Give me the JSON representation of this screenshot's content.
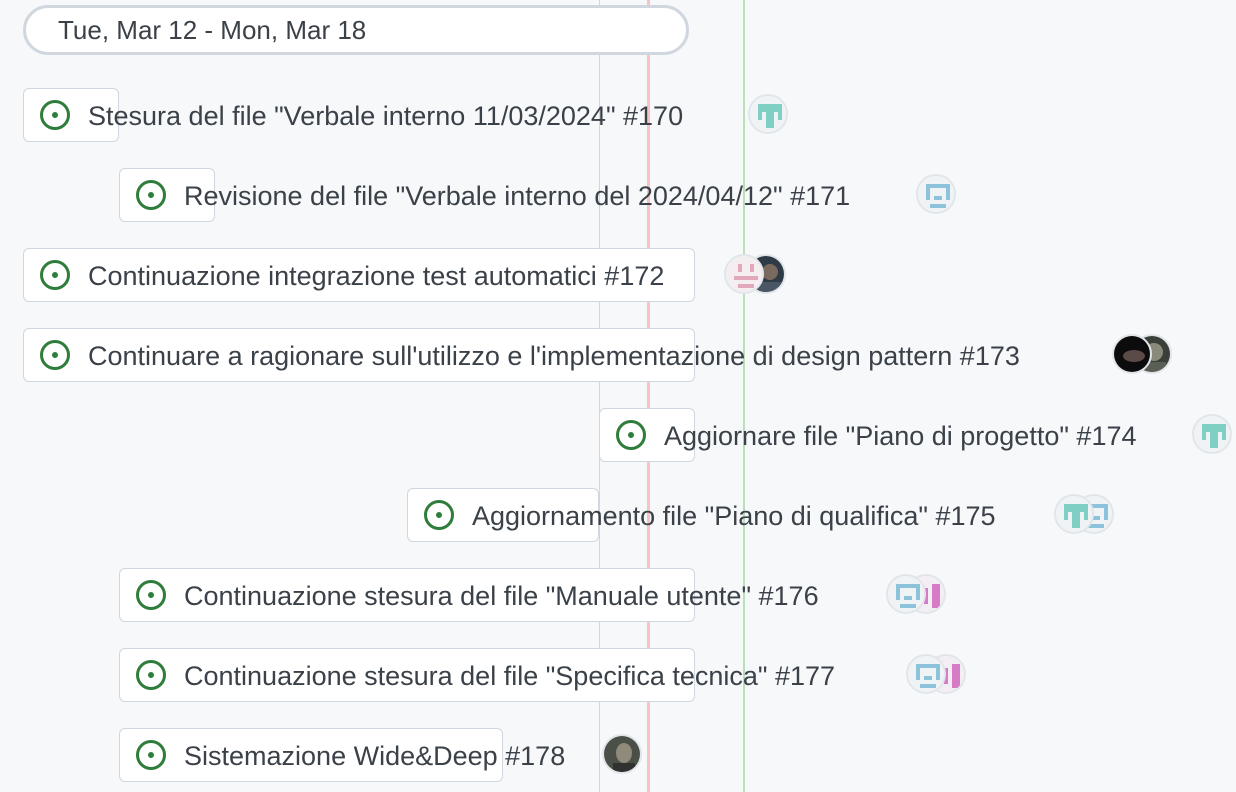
{
  "date_range": "Tue, Mar 12 - Mon, Mar 18",
  "colors": {
    "issue_open": "#2f7d3a",
    "today_line": "#f6c4c4",
    "iteration_line": "#b9e0b9"
  },
  "items": [
    {
      "title": "Stesura del file \"Verbale interno 11/03/2024\" #170",
      "assignees": [
        "teal-identicon-avatar"
      ]
    },
    {
      "title": "Revisione del file \"Verbale interno del 2024/04/12\" #171",
      "assignees": [
        "lightblue-identicon-avatar"
      ]
    },
    {
      "title": "Continuazione integrazione test automatici #172",
      "assignees": [
        "pink-identicon-avatar",
        "photo-avatar"
      ]
    },
    {
      "title": "Continuare a ragionare sull'utilizzo e l'implementazione di design pattern #173",
      "assignees": [
        "dark-photo-avatar",
        "photo-avatar"
      ]
    },
    {
      "title": "Aggiornare file \"Piano di progetto\" #174",
      "assignees": [
        "teal-identicon-avatar"
      ]
    },
    {
      "title": "Aggiornamento file \"Piano di qualifica\" #175",
      "assignees": [
        "teal-identicon-avatar",
        "lightblue-identicon-avatar"
      ]
    },
    {
      "title": "Continuazione stesura del file \"Manuale utente\" #176",
      "assignees": [
        "lightblue-identicon-avatar",
        "magenta-identicon-avatar"
      ]
    },
    {
      "title": "Continuazione stesura del file \"Specifica tecnica\" #177",
      "assignees": [
        "lightblue-identicon-avatar",
        "magenta-identicon-avatar"
      ]
    },
    {
      "title": "Sistemazione Wide&Deep #178",
      "assignees": [
        "photo-avatar"
      ]
    }
  ]
}
